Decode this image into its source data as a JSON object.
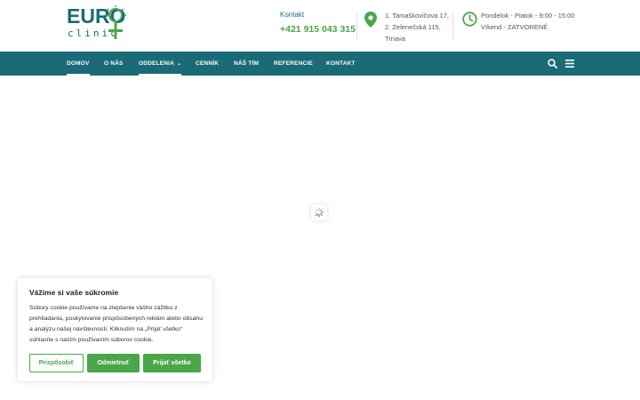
{
  "header": {
    "logo": {
      "word": "EURO",
      "sub": "clinic"
    },
    "contact": {
      "label": "Kontakt",
      "phone": "+421 915 043 315"
    },
    "address": {
      "line1": "1. Tamaškovičova 17,",
      "line2": "2. Zelenečská 115,",
      "line3": "Trnava"
    },
    "hours": {
      "line1": "Pondelok - Piatok - 9:00 - 15:00",
      "line2": "Víkend - ZATVORENÉ"
    }
  },
  "nav": {
    "items": [
      {
        "label": "DOMOV",
        "active": true
      },
      {
        "label": "O NÁS",
        "active": false
      },
      {
        "label": "ODDELENIA",
        "active": true,
        "dropdown": true
      },
      {
        "label": "CENNÍK",
        "active": false
      },
      {
        "label": "NÁŠ TÍM",
        "active": false
      },
      {
        "label": "REFERENCIE",
        "active": false
      },
      {
        "label": "KONTAKT",
        "active": false
      }
    ],
    "caret": "⌄"
  },
  "cookie": {
    "title": "Vážime si vaše súkromie",
    "text": "Súbory cookie používame na zlepšenie vášho zážitku z prehliadania, poskytovanie prispôsobených reklám alebo obsahu a analýzu našej návštevnosti. Kliknutím na „Prijať všetko“ súhlasíte s naším používaním súborov cookie.",
    "buttons": {
      "customize": "Prispôsobiť",
      "reject": "Odmietnuť",
      "accept": "Prijať všetko"
    }
  },
  "colors": {
    "primary": "#1b6a78",
    "accent": "#4aa64a"
  },
  "icons": {
    "address": "map-pin-icon",
    "hours": "clock-icon",
    "search": "search-icon",
    "menu": "hamburger-menu-icon",
    "loader": "spinner-icon"
  }
}
